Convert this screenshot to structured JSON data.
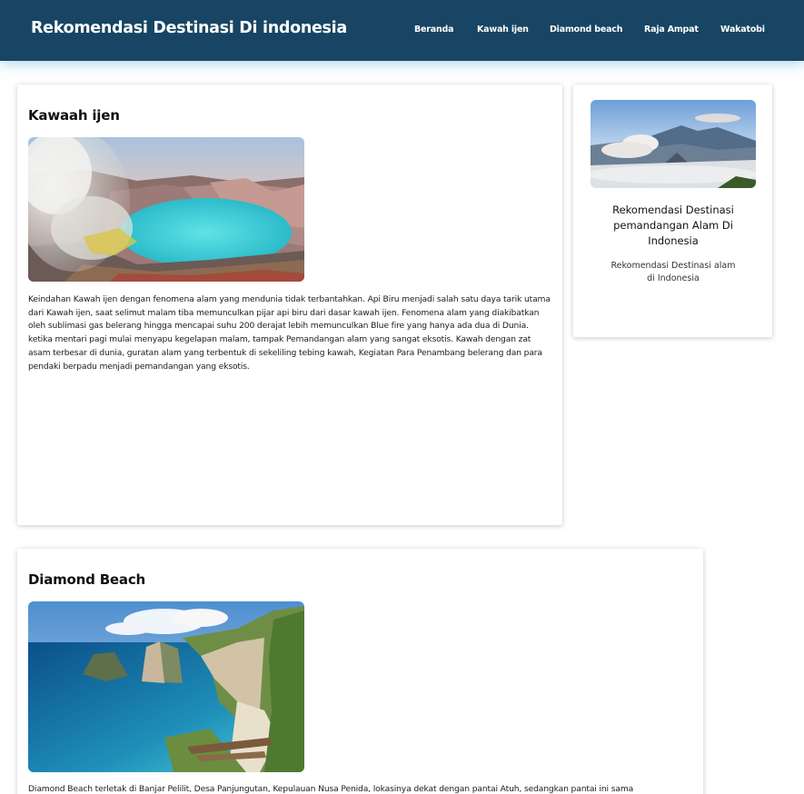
{
  "header": {
    "site_title": "Rekomendasi Destinasi Di indonesia",
    "nav": [
      "Beranda",
      "Kawah ijen",
      "Diamond beach",
      "Raja Ampat",
      "Wakatobi"
    ],
    "background_color": "#174563"
  },
  "articles": [
    {
      "title": "Kawaah ijen",
      "image": "kawah-ijen-crater-lake-photo",
      "text": "Keindahan Kawah ijen dengan fenomena alam yang mendunia tidak terbantahkan. Api Biru menjadi salah satu daya tarik utama dari Kawah ijen, saat selimut malam tiba memunculkan pijar api biru dari dasar kawah ijen. Fenomena alam yang diakibatkan oleh sublimasi gas belerang hingga mencapai suhu 200 derajat lebih memunculkan Blue fire yang hanya ada dua di Dunia. ketika mentari pagi mulai menyapu kegelapan malam, tampak Pemandangan alam yang sangat eksotis. Kawah dengan zat asam terbesar di dunia, guratan alam yang terbentuk di sekeliling tebing kawah, Kegiatan Para Penambang belerang dan para pendaki berpadu menjadi pemandangan yang eksotis."
    },
    {
      "title": "Diamond Beach",
      "image": "diamond-beach-coast-photo",
      "text": "Diamond Beach terletak di Banjar Pelilit, Desa Panjungutan, Kepulauan Nusa Penida, lokasinya dekat dengan pantai Atuh, sedangkan pantai ini sama"
    }
  ],
  "sidebar": {
    "image": "bromo-mountain-landscape-photo",
    "title": "Rekomendasi Destinasi pemandangan Alam Di Indonesia",
    "description": "Rekomendasi Destinasi alam di Indonesia"
  }
}
